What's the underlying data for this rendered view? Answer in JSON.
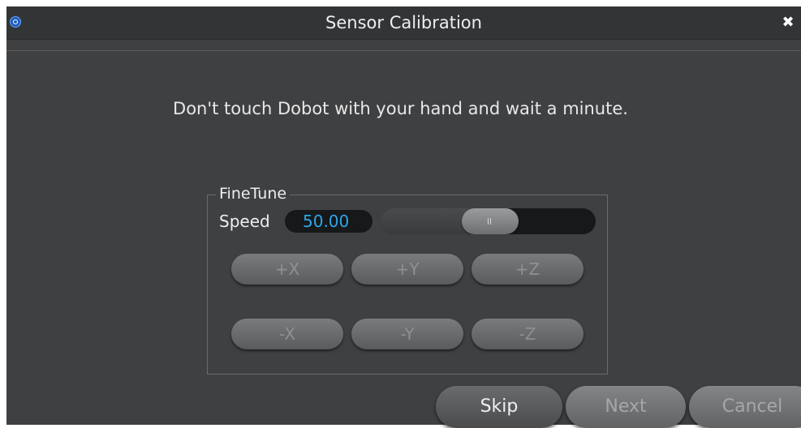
{
  "window": {
    "title": "Sensor Calibration",
    "close_glyph": "✖"
  },
  "message": "Don't touch Dobot with your hand and wait a minute.",
  "finetune": {
    "legend": "FineTune",
    "speed_label": "Speed",
    "speed_value": "50.00",
    "speed_slider_fraction": 0.5,
    "buttons_row1": [
      "+X",
      "+Y",
      "+Z"
    ],
    "buttons_row2": [
      "-X",
      "-Y",
      "-Z"
    ]
  },
  "footer": {
    "skip": "Skip",
    "next": "Next",
    "cancel": "Cancel"
  },
  "colors": {
    "window_bg": "#3f4042",
    "titlebar_bg": "#333436",
    "accent_value": "#2ea6e8"
  },
  "icons": {
    "app": "dobot-app-icon",
    "close": "close-icon"
  }
}
